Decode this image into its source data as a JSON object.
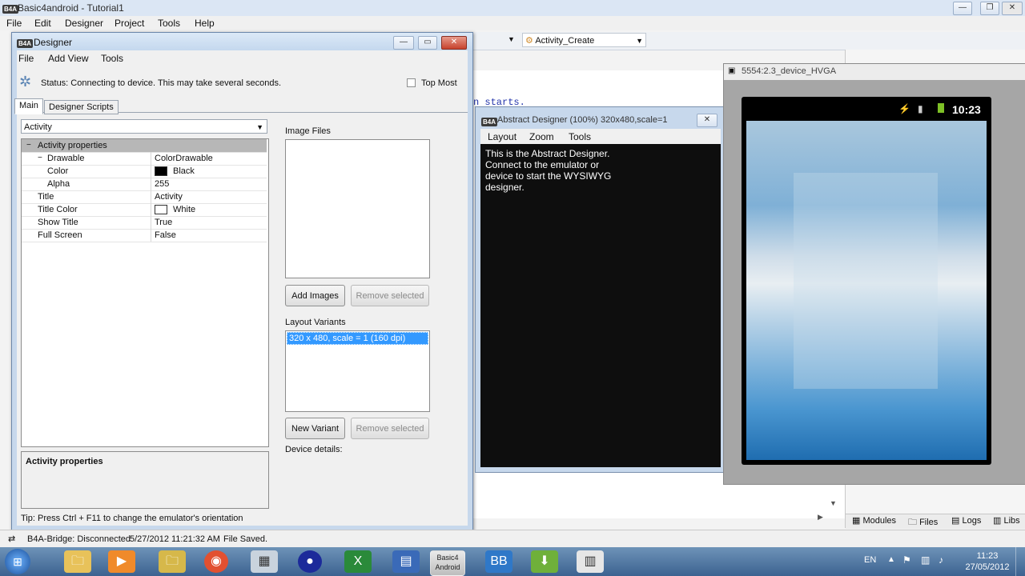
{
  "ide": {
    "window_title": "Basic4android - Tutorial1",
    "menu": [
      "File",
      "Edit",
      "Designer",
      "Project",
      "Tools",
      "Help"
    ],
    "sub_dropdown": "Activity_Create",
    "code_fragment": "n starts.",
    "right_tabs": [
      "Modules",
      "Files",
      "Logs",
      "Libs"
    ]
  },
  "designer": {
    "title": "Designer",
    "menu": [
      "File",
      "Add View",
      "Tools"
    ],
    "status": "Status: Connecting to device. This may take several seconds.",
    "top_most": "Top Most",
    "tabs": [
      "Main",
      "Designer Scripts"
    ],
    "view_select": "Activity",
    "properties": [
      {
        "name": "Activity properties",
        "value": "",
        "level": 0,
        "header": true
      },
      {
        "name": "Drawable",
        "value": "ColorDrawable",
        "level": 1,
        "toggle": "−"
      },
      {
        "name": "Color",
        "value": "Black",
        "level": 2,
        "swatch": "#000000"
      },
      {
        "name": "Alpha",
        "value": "255",
        "level": 2
      },
      {
        "name": "Title",
        "value": "Activity",
        "level": 1
      },
      {
        "name": "Title Color",
        "value": "White",
        "level": 1,
        "swatch": "#ffffff"
      },
      {
        "name": "Show Title",
        "value": "True",
        "level": 1
      },
      {
        "name": "Full Screen",
        "value": "False",
        "level": 1
      }
    ],
    "desc_title": "Activity properties",
    "tip": "Tip: Press Ctrl + F11 to change the emulator's orientation",
    "image_files_label": "Image Files",
    "add_images": "Add Images",
    "remove_selected_1": "Remove selected",
    "layout_variants_label": "Layout Variants",
    "variant_selected": "320 x 480, scale = 1 (160 dpi)",
    "new_variant": "New Variant",
    "remove_selected_2": "Remove selected",
    "device_details": "Device details:"
  },
  "abstract_designer": {
    "title": "Abstract Designer (100%) 320x480,scale=1",
    "menu": [
      "Layout",
      "Zoom",
      "Tools"
    ],
    "message": "This is the Abstract Designer. Connect to the emulator or device to start the WYSIWYG designer."
  },
  "emulator": {
    "title": "5554:2.3_device_HVGA",
    "time": "10:23"
  },
  "statusbar": {
    "bridge": "B4A-Bridge: Disconnected",
    "timestamp": "5/27/2012 11:21:32 AM",
    "file_state": "File Saved."
  },
  "taskbar": {
    "lang": "EN",
    "time": "11:23",
    "date": "27/05/2012",
    "active_app": "Basic4 Android"
  }
}
